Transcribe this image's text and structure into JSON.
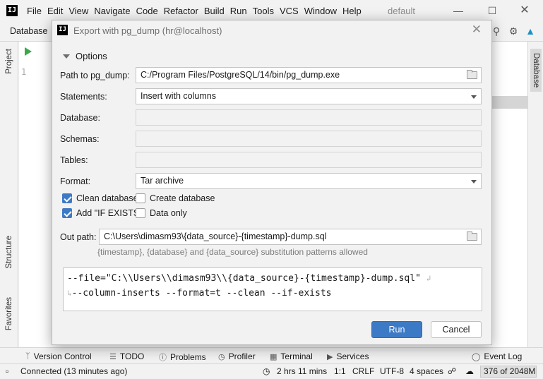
{
  "app": {
    "logo": "IJ",
    "menu": [
      "File",
      "Edit",
      "View",
      "Navigate",
      "Code",
      "Refactor",
      "Build",
      "Run",
      "Tools",
      "VCS",
      "Window",
      "Help"
    ],
    "project_name": "default",
    "nav_title": "Database"
  },
  "editor": {
    "line_number": "1"
  },
  "side_tabs": {
    "left": [
      "Project",
      "Structure",
      "Favorites"
    ],
    "right": [
      "Database"
    ]
  },
  "toolwindows": {
    "version_control": "Version Control",
    "todo": "TODO",
    "problems": "Problems",
    "profiler": "Profiler",
    "terminal": "Terminal",
    "services": "Services",
    "event_log": "Event Log"
  },
  "status": {
    "connection": "Connected (13 minutes ago)",
    "time": "2 hrs 11 mins",
    "position": "1:1",
    "line_sep": "CRLF",
    "encoding": "UTF-8",
    "indent": "4 spaces",
    "memory": "376 of 2048M"
  },
  "dialog": {
    "title": "Export with pg_dump (hr@localhost)",
    "options_label": "Options",
    "path_label": "Path to pg_dump:",
    "path_value": "C:/Program Files/PostgreSQL/14/bin/pg_dump.exe",
    "statements_label": "Statements:",
    "statements_value": "Insert with columns",
    "database_label": "Database:",
    "schemas_label": "Schemas:",
    "tables_label": "Tables:",
    "format_label": "Format:",
    "format_value": "Tar archive",
    "clean_db_label": "Clean database",
    "clean_db_checked": true,
    "create_db_label": "Create database",
    "create_db_checked": false,
    "if_exists_label": "Add \"IF EXISTS\"",
    "if_exists_checked": true,
    "data_only_label": "Data only",
    "data_only_checked": false,
    "out_path_label": "Out path:",
    "out_path_value": "C:\\Users\\dimasm93\\{data_source}-{timestamp}-dump.sql",
    "hint": "{timestamp}, {database} and {data_source} substitution patterns allowed",
    "command_line1": "--file=\"C:\\\\Users\\\\dimasm93\\\\{data_source}-{timestamp}-dump.sql\"",
    "command_line2": "--column-inserts --format=t --clean --if-exists",
    "run_label": "Run",
    "cancel_label": "Cancel"
  },
  "colors": {
    "accent": "#3d7ac6",
    "run_icon": "#3ba94b"
  }
}
